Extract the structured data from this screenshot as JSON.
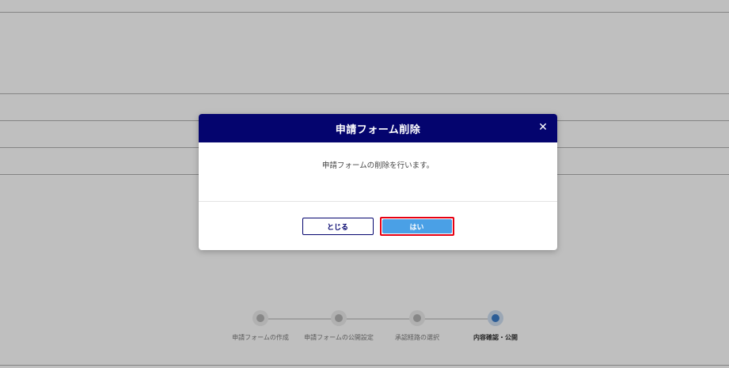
{
  "modal": {
    "title": "申請フォーム削除",
    "message": "申請フォームの削除を行います。",
    "close_icon": "close-icon",
    "close_glyph": "✕",
    "buttons": {
      "close_label": "とじる",
      "yes_label": "はい"
    },
    "header_color": "#04046e",
    "primary_color": "#4aa0e6",
    "highlight_color": "#e60012"
  },
  "stepper": {
    "steps": [
      {
        "label": "申請フォームの作成",
        "state": "inactive"
      },
      {
        "label": "申請フォームの公開設定",
        "state": "inactive"
      },
      {
        "label": "承認経路の選択",
        "state": "inactive"
      },
      {
        "label": "内容確認・公開",
        "state": "active"
      }
    ],
    "active_color": "#3b7cc9"
  }
}
